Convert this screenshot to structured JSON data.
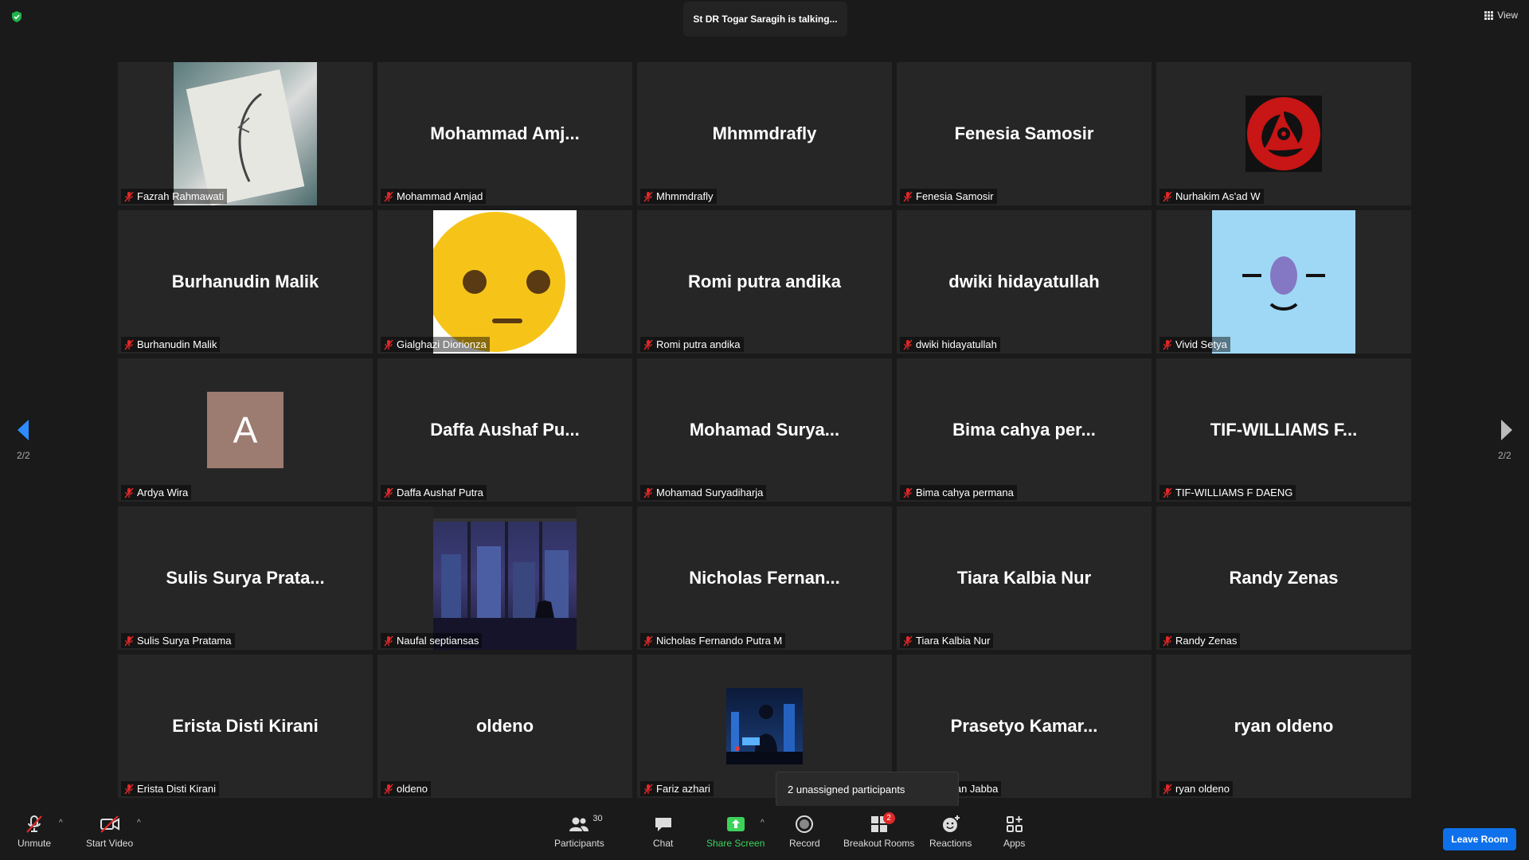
{
  "talking_banner": "St DR Togar Saragih is talking...",
  "view_label": "View",
  "pager": {
    "current": "2/2"
  },
  "tooltip": "2 unassigned participants",
  "tiles": [
    {
      "name": "Fazrah Rahmawati",
      "display": "",
      "pic": "sketch"
    },
    {
      "name": "Mohammad Amjad",
      "display": "Mohammad  Amj...",
      "pic": ""
    },
    {
      "name": "Mhmmdrafly",
      "display": "Mhmmdrafly",
      "pic": ""
    },
    {
      "name": "Fenesia Samosir",
      "display": "Fenesia Samosir",
      "pic": ""
    },
    {
      "name": "Nurhakim As'ad W",
      "display": "",
      "pic": "sharingan"
    },
    {
      "name": "Burhanudin Malik",
      "display": "Burhanudin Malik",
      "pic": ""
    },
    {
      "name": "Gialghazi Diorionza",
      "display": "",
      "pic": "emoji"
    },
    {
      "name": "Romi putra andika",
      "display": "Romi putra andika",
      "pic": ""
    },
    {
      "name": "dwiki hidayatullah",
      "display": "dwiki hidayatullah",
      "pic": ""
    },
    {
      "name": "Vivid Setya",
      "display": "",
      "pic": "blueface"
    },
    {
      "name": "Ardya Wira",
      "display": "",
      "pic": "letterA",
      "letter": "A"
    },
    {
      "name": "Daffa Aushaf Putra",
      "display": "Daffa Aushaf Pu...",
      "pic": ""
    },
    {
      "name": "Mohamad Suryadiharja",
      "display": "Mohamad  Surya...",
      "pic": ""
    },
    {
      "name": "Bima cahya permana",
      "display": "Bima cahya per...",
      "pic": ""
    },
    {
      "name": "TIF-WILLIAMS F DAENG",
      "display": "TIF-WILLIAMS  F...",
      "pic": ""
    },
    {
      "name": "Sulis Surya Pratama",
      "display": "Sulis Surya Prata...",
      "pic": ""
    },
    {
      "name": "Naufal septiansas",
      "display": "",
      "pic": "city"
    },
    {
      "name": "Nicholas Fernando Putra M",
      "display": "Nicholas  Fernan...",
      "pic": ""
    },
    {
      "name": "Tiara Kalbia Nur",
      "display": "Tiara Kalbia Nur",
      "pic": ""
    },
    {
      "name": "Randy Zenas",
      "display": "Randy Zenas",
      "pic": ""
    },
    {
      "name": "Erista Disti Kirani",
      "display": "Erista Disti Kirani",
      "pic": ""
    },
    {
      "name": "oldeno",
      "display": "oldeno",
      "pic": ""
    },
    {
      "name": "Fariz azhari",
      "display": "",
      "pic": "night"
    },
    {
      "name": "aruzzaman Jabba",
      "display": "Prasetyo  Kamar...",
      "pic": ""
    },
    {
      "name": "ryan oldeno",
      "display": "ryan oldeno",
      "pic": ""
    }
  ],
  "toolbar": {
    "unmute": "Unmute",
    "start_video": "Start Video",
    "participants": "Participants",
    "participants_count": "30",
    "chat": "Chat",
    "share_screen": "Share Screen",
    "record": "Record",
    "breakout_rooms": "Breakout Rooms",
    "breakout_badge": "2",
    "reactions": "Reactions",
    "apps": "Apps",
    "leave": "Leave Room"
  },
  "colors": {
    "share_green": "#3cd25c",
    "leave_blue": "#0e71eb",
    "mute_red": "#e02828"
  }
}
